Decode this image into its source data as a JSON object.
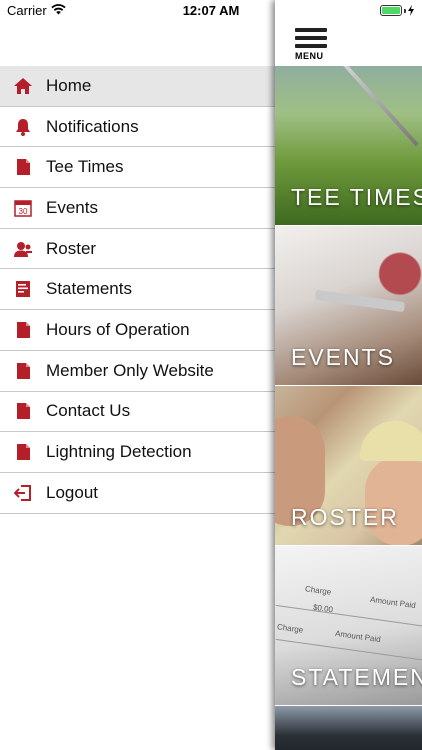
{
  "status_bar": {
    "carrier": "Carrier",
    "time": "12:07 AM"
  },
  "menu": {
    "items": [
      {
        "label": "Home",
        "icon": "home-icon",
        "active": true
      },
      {
        "label": "Notifications",
        "icon": "bell-icon"
      },
      {
        "label": "Tee Times",
        "icon": "document-icon"
      },
      {
        "label": "Events",
        "icon": "calendar-icon",
        "calendar_day": "30"
      },
      {
        "label": "Roster",
        "icon": "people-icon"
      },
      {
        "label": "Statements",
        "icon": "statement-icon"
      },
      {
        "label": "Hours of Operation",
        "icon": "document-icon"
      },
      {
        "label": "Member Only Website",
        "icon": "document-icon"
      },
      {
        "label": "Contact Us",
        "icon": "document-icon"
      },
      {
        "label": "Lightning Detection",
        "icon": "document-icon"
      },
      {
        "label": "Logout",
        "icon": "logout-icon"
      }
    ]
  },
  "header": {
    "menu_label": "MENU"
  },
  "tiles": [
    {
      "label": "TEE TIMES"
    },
    {
      "label": "EVENTS"
    },
    {
      "label": "ROSTER"
    },
    {
      "label": "STATEMENTS"
    }
  ],
  "statement_preview": {
    "charge": "Charge",
    "amount_paid": "Amount Paid",
    "amount": "$0.00"
  },
  "colors": {
    "accent": "#b51f2a",
    "active_row": "#e6e6e6",
    "divider": "#c8c8c8"
  }
}
